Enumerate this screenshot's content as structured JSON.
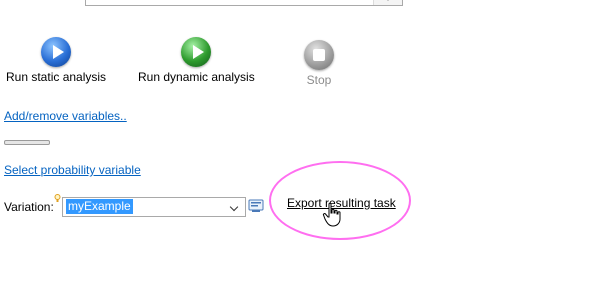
{
  "toolbar": {
    "run_static_label": "Run static analysis",
    "run_dynamic_label": "Run dynamic analysis",
    "stop_label": "Stop"
  },
  "links": {
    "add_remove_variables": "Add/remove variables..",
    "select_probability_variable": "Select probability variable",
    "export_resulting_task": "Export resulting task"
  },
  "variation": {
    "label": "Variation:",
    "value": "myExample"
  },
  "colors": {
    "static_button": "#2a6fd6",
    "dynamic_button": "#2e9b2e",
    "stop_button": "#8a8a8a",
    "link": "#0563c1",
    "selection": "#3399ff",
    "highlight_ellipse": "#ff6ef0"
  },
  "icons": {
    "static": "play-icon",
    "dynamic": "play-icon",
    "stop": "stop-icon",
    "dropdown": "chevron-down-icon",
    "browse": "browse-icon",
    "cursor": "hand-cursor-icon",
    "hint": "lightbulb-icon"
  }
}
